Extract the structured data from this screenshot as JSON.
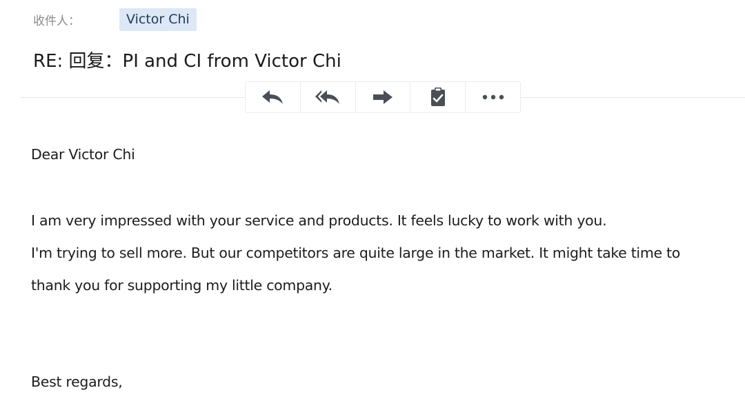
{
  "recipient": {
    "label": "收件人：",
    "name": "Victor Chi"
  },
  "subject": "RE: 回复：PI and CI from Victor Chi",
  "toolbar": {
    "buttons": [
      {
        "name": "reply-icon"
      },
      {
        "name": "reply-all-icon"
      },
      {
        "name": "forward-icon"
      },
      {
        "name": "clipboard-icon"
      },
      {
        "name": "more-icon"
      }
    ]
  },
  "message": {
    "greeting": "Dear Victor Chi",
    "lines": [
      "I am very impressed with your service and products. It feels lucky to work with you.",
      "I'm trying to sell more. But our competitors are quite large in the market. It might take time to",
      "thank you for supporting my little company."
    ],
    "closing": "Best regards,"
  },
  "colors": {
    "chip_background": "#dce8f6",
    "icon": "#4a4f57"
  }
}
